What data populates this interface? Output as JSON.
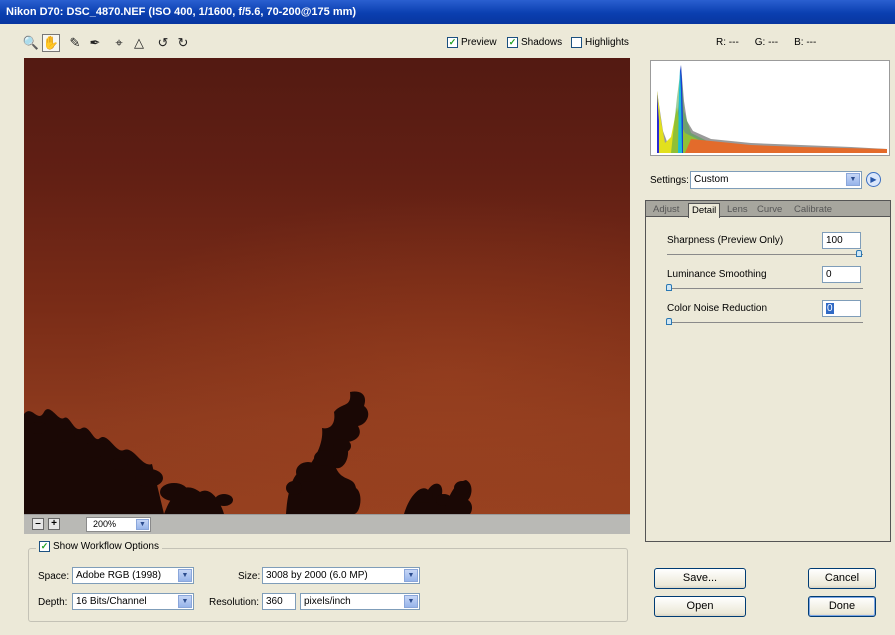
{
  "window": {
    "title": "Nikon D70: DSC_4870.NEF (ISO 400, 1/1600, f/5.6, 70-200@175 mm)"
  },
  "toolbar": {
    "tools": [
      "zoom-icon",
      "hand-icon",
      "white-balance-eyedropper-icon",
      "color-sampler-icon",
      "crop-icon",
      "straighten-icon",
      "rotate-left-icon",
      "rotate-right-icon"
    ],
    "active_tool": "hand-icon",
    "preview": {
      "label": "Preview",
      "checked": true
    },
    "shadows": {
      "label": "Shadows",
      "checked": true
    },
    "highlights": {
      "label": "Highlights",
      "checked": false
    }
  },
  "readout": {
    "r": "R: ---",
    "g": "G: ---",
    "b": "B: ---"
  },
  "zoom": {
    "minus": "–",
    "plus": "+",
    "value": "200%"
  },
  "workflow": {
    "show_label": "Show Workflow Options",
    "show_checked": true,
    "space_label": "Space:",
    "space_value": "Adobe RGB (1998)",
    "depth_label": "Depth:",
    "depth_value": "16 Bits/Channel",
    "size_label": "Size:",
    "size_value": "3008 by 2000 (6.0 MP)",
    "resolution_label": "Resolution:",
    "resolution_value": "360",
    "resolution_unit": "pixels/inch"
  },
  "settings": {
    "label": "Settings:",
    "value": "Custom"
  },
  "tabs": [
    "Adjust",
    "Detail",
    "Lens",
    "Curve",
    "Calibrate"
  ],
  "active_tab": "Detail",
  "detail": {
    "sharpness_label": "Sharpness (Preview Only)",
    "sharpness_value": "100",
    "luminance_label": "Luminance Smoothing",
    "luminance_value": "0",
    "color_noise_label": "Color Noise Reduction",
    "color_noise_value": "0",
    "sharpness_level": 1.0,
    "luminance_level": 0,
    "color_noise_level": 0
  },
  "buttons": {
    "save": "Save...",
    "cancel": "Cancel",
    "open": "Open",
    "done": "Done"
  },
  "colors": {
    "titlebar": "#0a3fb0",
    "sky": "#7a2c17",
    "check": "#21a121"
  }
}
